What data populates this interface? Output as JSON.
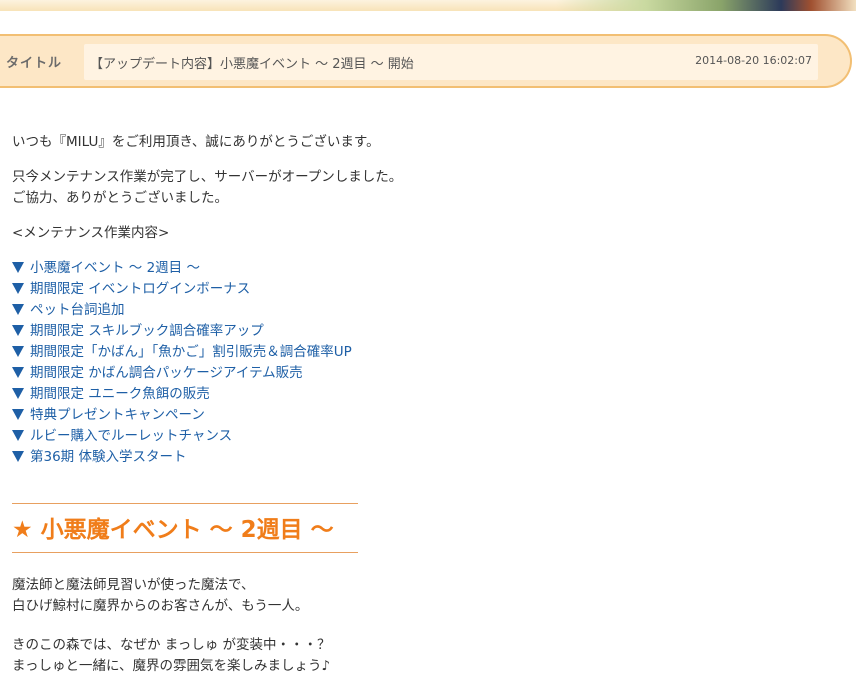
{
  "header": {
    "title_label": "タイトル",
    "title": "【アップデート内容】小悪魔イベント ～ 2週目 ～ 開始",
    "date": "2014-08-20 16:02:07"
  },
  "intro": {
    "greeting": "いつも『MILU』をご利用頂き、誠にありがとうございます。",
    "notice_line1": "只今メンテナンス作業が完了し、サーバーがオープンしました。",
    "notice_line2": "ご協力、ありがとうございました。",
    "maintenance_heading": "<メンテナンス作業内容>"
  },
  "menu": {
    "items": [
      "小悪魔イベント ～ 2週目 ～",
      "期間限定 イベントログインボーナス",
      "ペット台詞追加",
      "期間限定 スキルブック調合確率アップ",
      "期間限定「かばん」「魚かご」割引販売＆調合確率UP",
      "期間限定 かばん調合パッケージアイテム販売",
      "期間限定 ユニーク魚餌の販売",
      "特典プレゼントキャンペーン",
      "ルビー購入でルーレットチャンス",
      "第36期 体験入学スタート"
    ]
  },
  "section": {
    "heading": "小悪魔イベント ～ 2週目 ～",
    "p1_line1": "魔法師と魔法師見習いが使った魔法で、",
    "p1_line2": "白ひげ鯨村に魔界からのお客さんが、もう一人。",
    "p2_line1": "きのこの森では、なぜか まっしゅ が変装中・・・？",
    "p2_line2": "まっしゅと一緒に、魔界の雰囲気を楽しみましょう♪"
  },
  "colors": {
    "link": "#1e5fa6",
    "accent": "#f07d1a",
    "title_bar": "#fde7c6"
  }
}
